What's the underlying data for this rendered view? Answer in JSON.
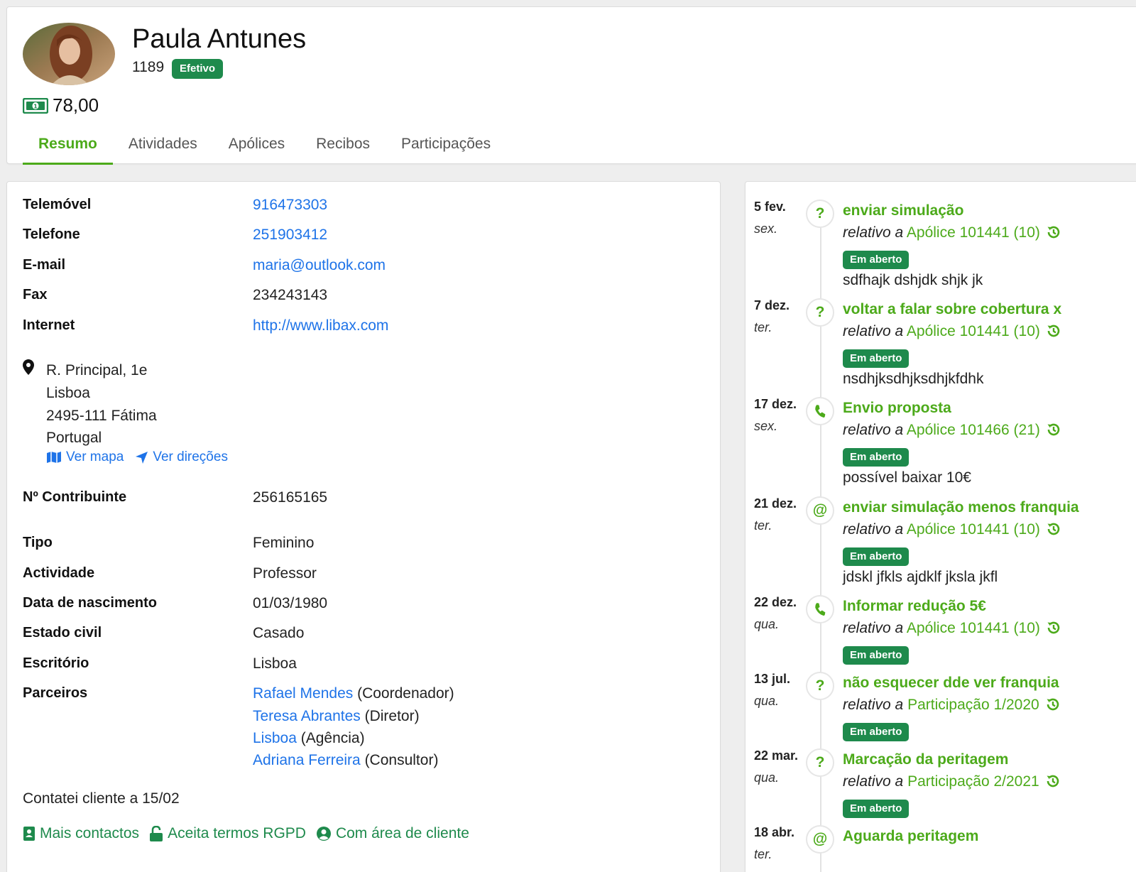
{
  "client": {
    "name": "Paula Antunes",
    "number": "1189",
    "status": "Efetivo",
    "balance": "78,00"
  },
  "tabs": [
    "Resumo",
    "Atividades",
    "Apólices",
    "Recibos",
    "Participações"
  ],
  "contact": {
    "mobile_label": "Telemóvel",
    "mobile": "916473303",
    "phone_label": "Telefone",
    "phone": "251903412",
    "email_label": "E-mail",
    "email": "maria@outlook.com",
    "fax_label": "Fax",
    "fax": "234243143",
    "internet_label": "Internet",
    "internet": "http://www.libax.com"
  },
  "address": {
    "line1": "R. Principal, 1e",
    "line2": "Lisboa",
    "line3": "2495-111 Fátima",
    "line4": "Portugal",
    "map_link": "Ver mapa",
    "directions_link": "Ver direções"
  },
  "details": {
    "nif_label": "Nº Contribuinte",
    "nif": "256165165",
    "type_label": "Tipo",
    "type": "Feminino",
    "activity_label": "Actividade",
    "activity": "Professor",
    "birth_label": "Data de nascimento",
    "birth": "01/03/1980",
    "civil_label": "Estado civil",
    "civil": "Casado",
    "office_label": "Escritório",
    "office": "Lisboa",
    "partners_label": "Parceiros",
    "partners": [
      {
        "name": "Rafael Mendes",
        "role": " (Coordenador)"
      },
      {
        "name": "Teresa Abrantes",
        "role": " (Diretor)"
      },
      {
        "name": "Lisboa",
        "role": " (Agência)"
      },
      {
        "name": "Adriana Ferreira",
        "role": " (Consultor)"
      }
    ],
    "note": "Contatei cliente a 15/02"
  },
  "footer": {
    "more_contacts": "Mais contactos",
    "rgpd": "Aceita termos RGPD",
    "client_area": "Com área de cliente"
  },
  "timeline": {
    "relative_prefix": "relativo a",
    "items": [
      {
        "date": "5 fev.",
        "day": "sex.",
        "icon": "question-icon",
        "title": "enviar simulação",
        "ref": "Apólice 101441 (10)",
        "status": "Em aberto",
        "note": "sdfhajk dshjdk shjk jk"
      },
      {
        "date": "7 dez.",
        "day": "ter.",
        "icon": "question-icon",
        "title": "voltar a falar sobre cobertura x",
        "ref": "Apólice 101441 (10)",
        "status": "Em aberto",
        "note": "nsdhjksdhjksdhjkfdhk"
      },
      {
        "date": "17 dez.",
        "day": "sex.",
        "icon": "phone-icon",
        "title": "Envio proposta",
        "ref": "Apólice 101466 (21)",
        "status": "Em aberto",
        "note": "possível baixar 10€"
      },
      {
        "date": "21 dez.",
        "day": "ter.",
        "icon": "at-icon",
        "title": "enviar simulação menos franquia",
        "ref": "Apólice 101441 (10)",
        "status": "Em aberto",
        "note": "jdskl jfkls ajdklf jksla jkfl"
      },
      {
        "date": "22 dez.",
        "day": "qua.",
        "icon": "phone-icon",
        "title": "Informar redução 5€",
        "ref": "Apólice 101441 (10)",
        "status": "Em aberto",
        "note": ""
      },
      {
        "date": "13 jul.",
        "day": "qua.",
        "icon": "question-icon",
        "title": "não esquecer dde ver franquia",
        "ref": "Participação 1/2020",
        "status": "Em aberto",
        "note": ""
      },
      {
        "date": "22 mar.",
        "day": "qua.",
        "icon": "question-icon",
        "title": "Marcação da peritagem",
        "ref": "Participação 2/2021",
        "status": "Em aberto",
        "note": ""
      },
      {
        "date": "18 abr.",
        "day": "ter.",
        "icon": "at-icon",
        "title": "Aguarda peritagem",
        "ref": "",
        "status": "",
        "note": ""
      }
    ]
  },
  "colors": {
    "accent_green": "#4caa1a",
    "badge_green": "#1e8a4c",
    "link_blue": "#1e73e8"
  }
}
